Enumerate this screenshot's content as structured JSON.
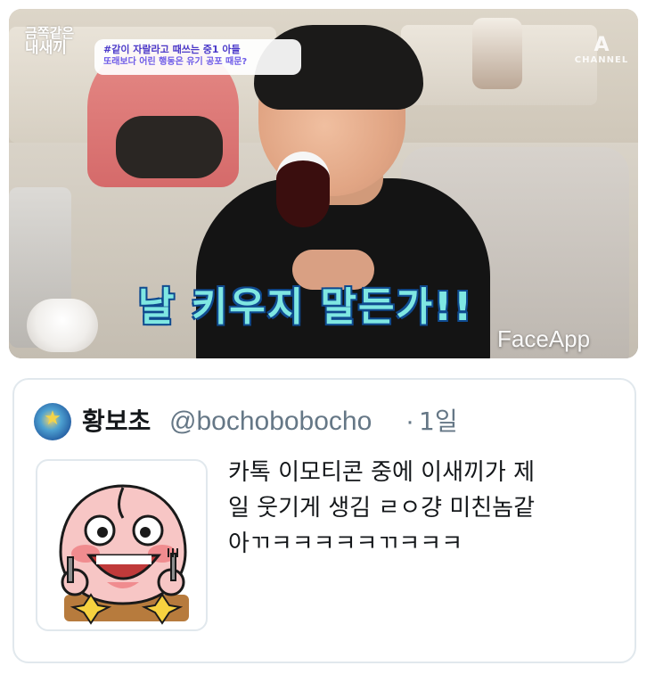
{
  "media": {
    "badge": {
      "line1": "#같이 자랄라고 때쓰는 중1 아들",
      "line2": "또래보다 어린 행동은 유기 공포 때문?"
    },
    "show_logo": {
      "line1": "금쪽같은",
      "line2": "내새끼"
    },
    "channel_logo": {
      "mark": "A",
      "text": "CHANNEL"
    },
    "subtitle": "날 키우지 말든가!!",
    "watermark": "FaceApp"
  },
  "tweet": {
    "display_name": "황보초",
    "handle": "@bochobobocho",
    "separator": "·",
    "timestamp": "1일",
    "text_lines": [
      "카톡 이모티콘 중에 이새끼가 제",
      "일 웃기게 생김 ㄹㅇ걍 미친놈같",
      "아ㄲㅋㅋㅋㅋㅋㄲㅋㅋㅋ"
    ],
    "avatar_icon": "earth-star-icon",
    "sticker_icon": "laughing-peach-icon"
  },
  "colors": {
    "subtitle_fill": "#7fe7e2",
    "subtitle_outline": "#0f4a8f",
    "muted_text": "#657786",
    "card_border": "#e1e8ed",
    "badge_text": "#4a39c9"
  }
}
